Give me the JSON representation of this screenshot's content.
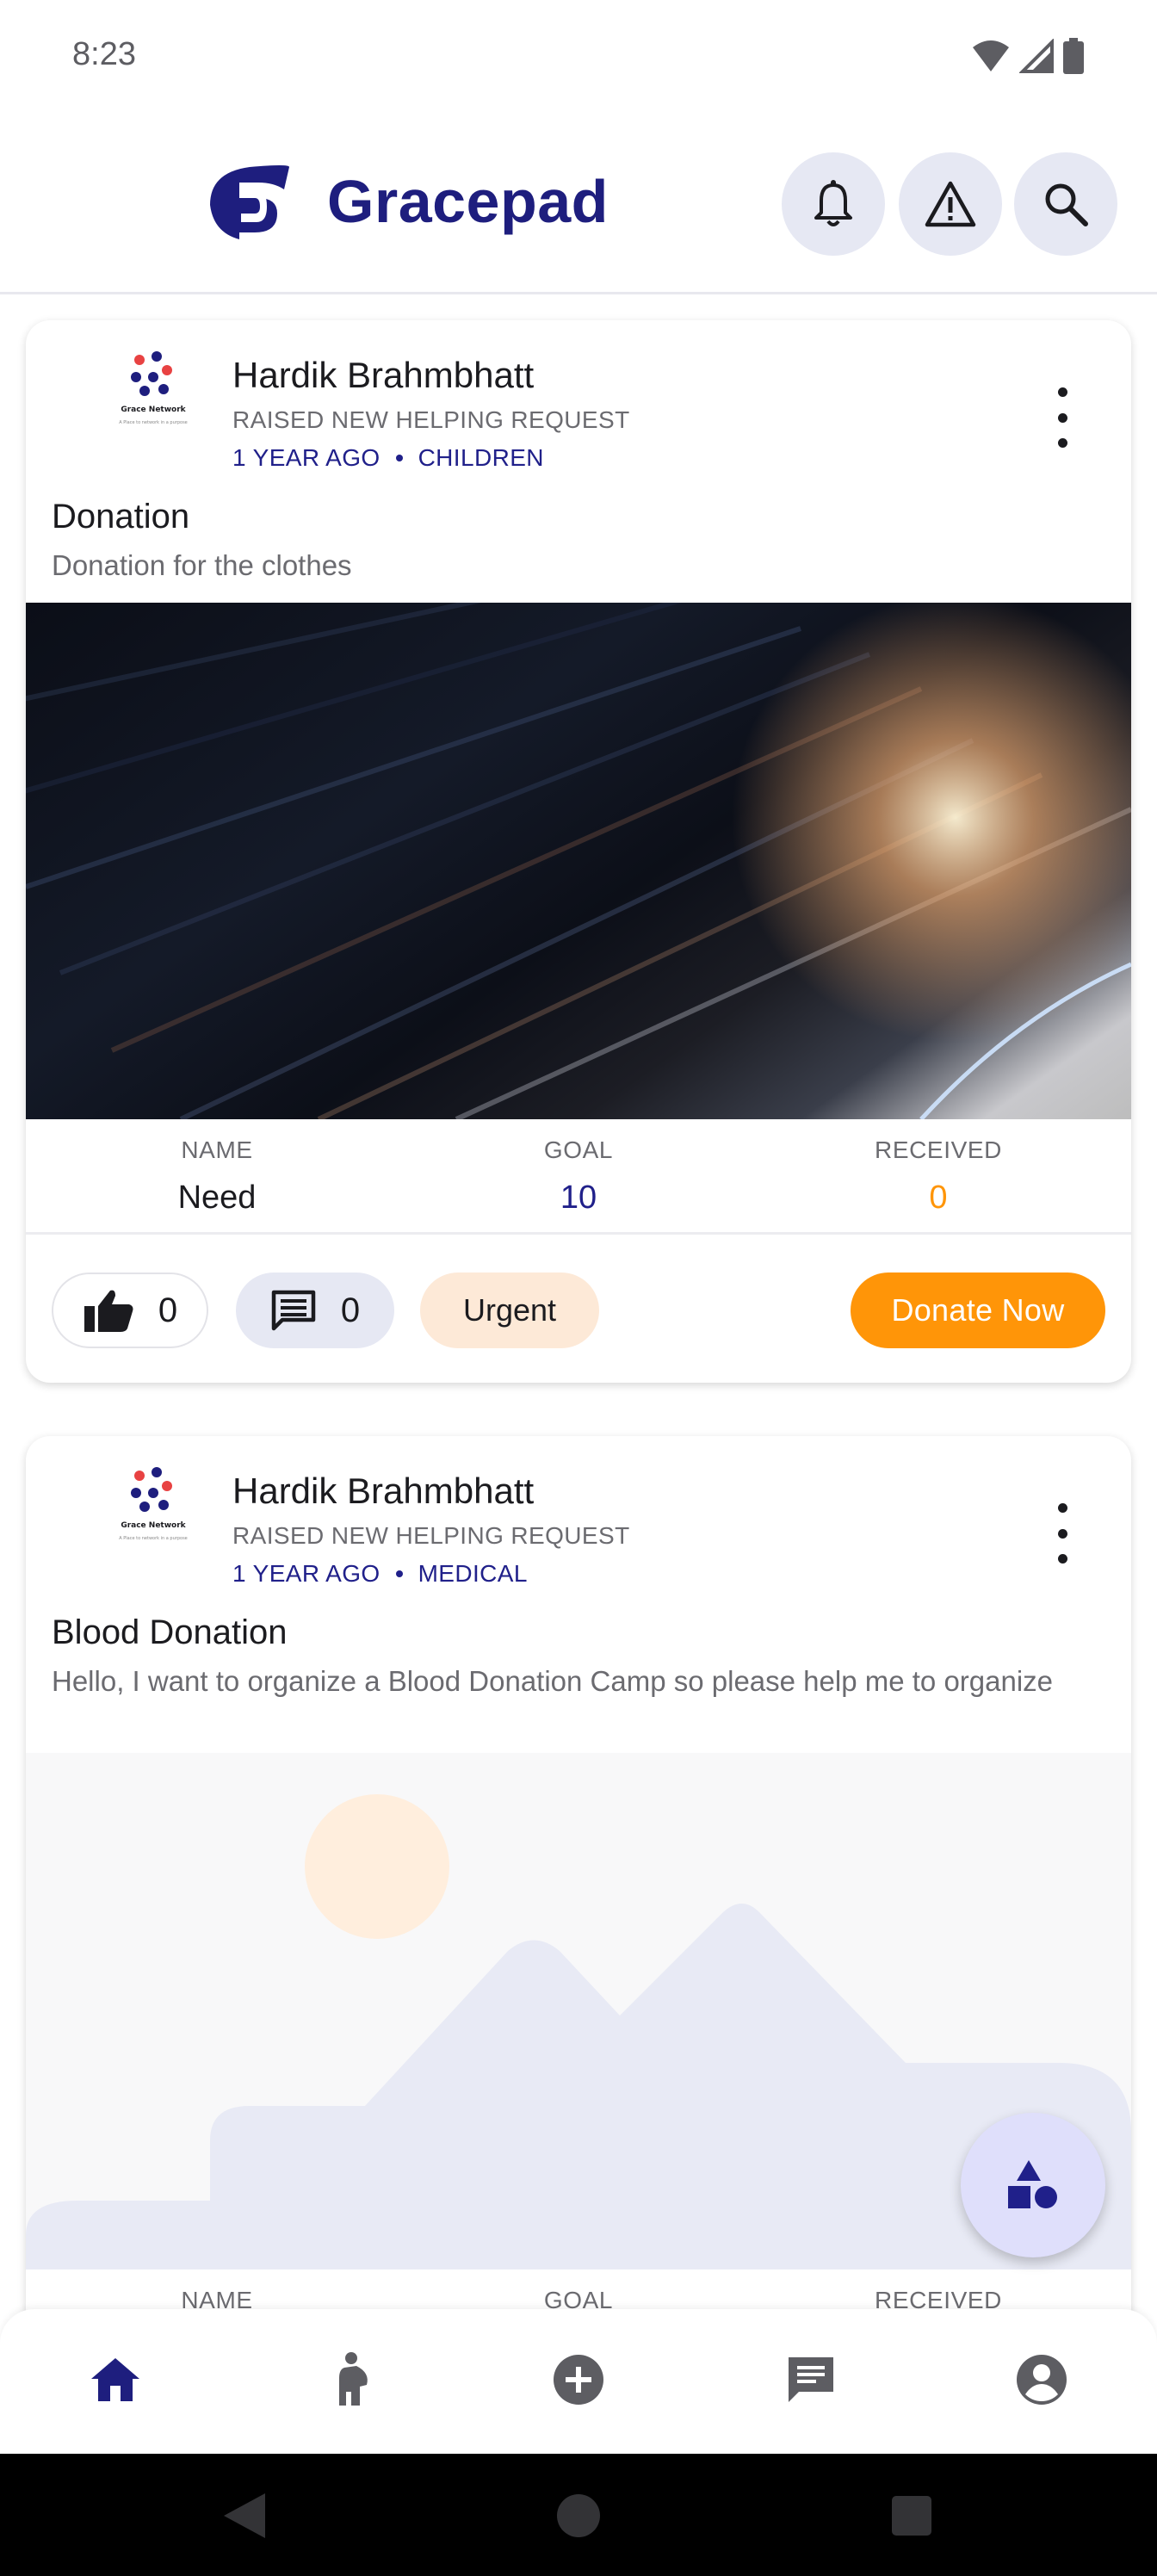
{
  "status_bar": {
    "time": "8:23",
    "icons": [
      "wifi-icon",
      "cellular-signal-icon",
      "battery-icon"
    ]
  },
  "header": {
    "app_name": "Gracepad",
    "brand_color": "#1e1e7e",
    "actions": [
      "notification-bell-icon",
      "warning-icon",
      "search-icon"
    ]
  },
  "posts": [
    {
      "user_name": "Hardik Brahmbhatt",
      "action": "RAISED NEW HELPING REQUEST",
      "time_ago": "1 YEAR AGO",
      "category": "CHILDREN",
      "title": "Donation",
      "description": "Donation for the clothes",
      "stats": {
        "name_label": "NAME",
        "name_value": "Need",
        "goal_label": "GOAL",
        "goal_value": "10",
        "received_label": "RECEIVED",
        "received_value": "0"
      },
      "likes": "0",
      "comments": "0",
      "tag": "Urgent",
      "donate_label": "Donate Now"
    },
    {
      "user_name": "Hardik Brahmbhatt",
      "action": "RAISED NEW HELPING REQUEST",
      "time_ago": "1 YEAR AGO",
      "category": "MEDICAL",
      "title": "Blood Donation",
      "description": "Hello, I want to organize a Blood Donation Camp so please help me to organize",
      "stats": {
        "name_label": "NAME",
        "goal_label": "GOAL",
        "received_label": "RECEIVED"
      }
    }
  ],
  "avatar_logo": {
    "org_name": "Grace Network",
    "tagline": "A Place to network in a purpose"
  },
  "colors": {
    "accent": "#ff9508",
    "goal": "#20208a",
    "received": "#ff9508",
    "fab": "#dfdffb"
  },
  "bottom_nav": [
    "home-icon",
    "pregnancy-icon",
    "add-circle-icon",
    "chat-icon",
    "account-icon"
  ],
  "system_nav": [
    "back-icon",
    "home-circle-icon",
    "recents-icon"
  ]
}
